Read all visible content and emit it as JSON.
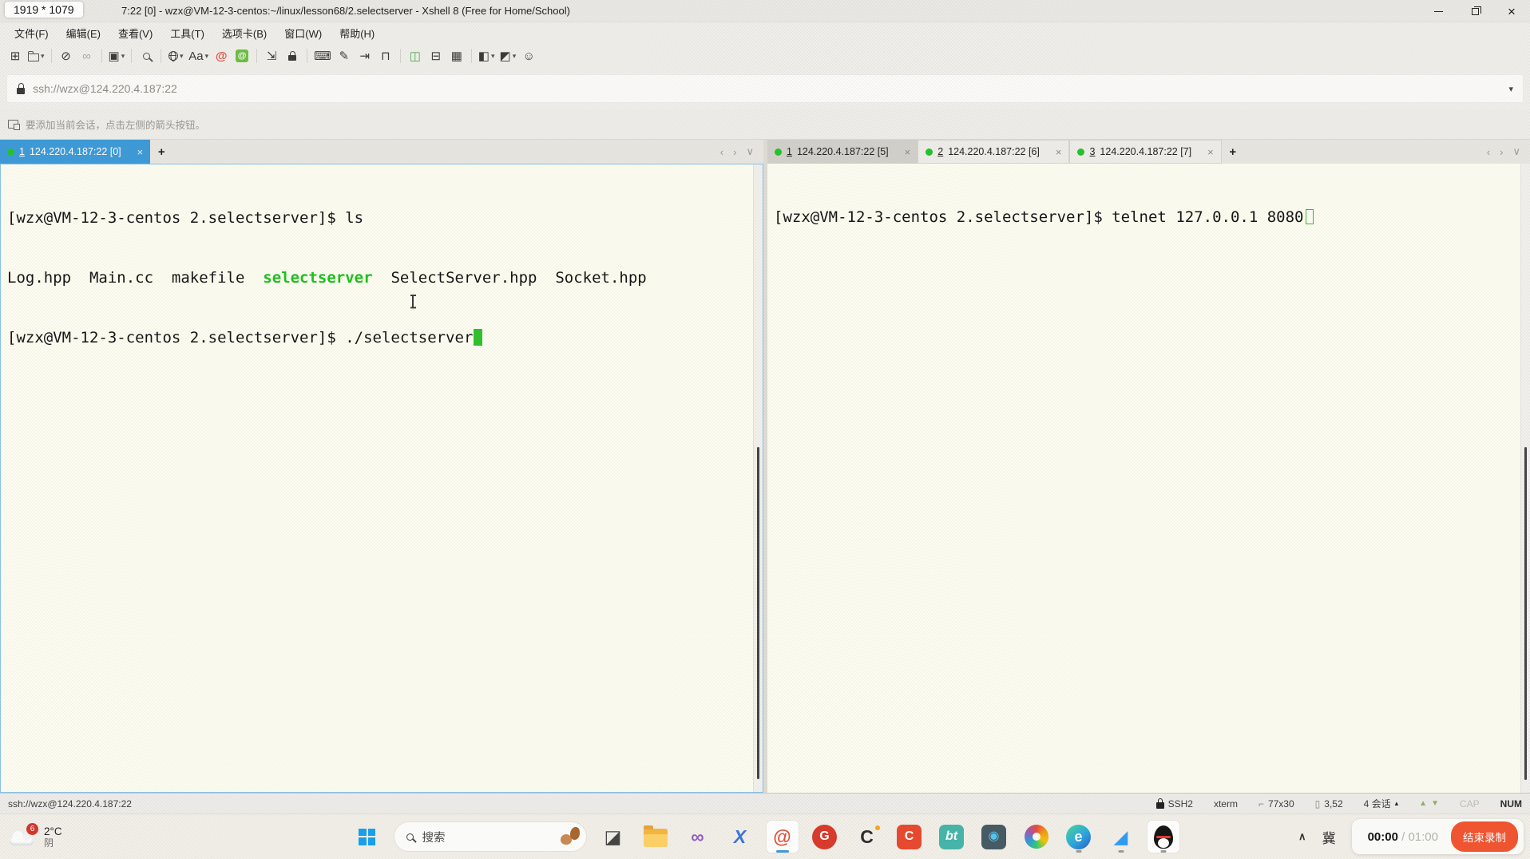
{
  "screen_badge": "1919 * 1079",
  "titlebar": {
    "title": "7:22 [0] - wzx@VM-12-3-centos:~/linux/lesson68/2.selectserver - Xshell 8 (Free for Home/School)"
  },
  "menubar": {
    "items": [
      "文件(F)",
      "编辑(E)",
      "查看(V)",
      "工具(T)",
      "选项卡(B)",
      "窗口(W)",
      "帮助(H)"
    ]
  },
  "toolbar": {
    "items": [
      {
        "name": "new-session-button",
        "glyph": "⊞"
      },
      {
        "name": "open-sessions-button",
        "css": "folder",
        "dropdown": true
      },
      {
        "sep": true
      },
      {
        "name": "disconnect-button",
        "glyph": "⊘"
      },
      {
        "name": "reconnect-button",
        "glyph": "∞",
        "disabled": true
      },
      {
        "sep": true
      },
      {
        "name": "new-terminal-tab-button",
        "glyph": "▣",
        "dropdown": true
      },
      {
        "sep": true
      },
      {
        "name": "find-button",
        "css": "search"
      },
      {
        "sep": true
      },
      {
        "name": "encoding-button",
        "css": "globe",
        "dropdown": true
      },
      {
        "name": "font-button",
        "glyph": "Aa",
        "dropdown": true
      },
      {
        "name": "xshell-logo-button",
        "glyph": "@",
        "color": "#E0523D",
        "bold": true
      },
      {
        "name": "xftp-transfer-button",
        "glyph": "@",
        "chip": "#6DBE45"
      },
      {
        "sep": true
      },
      {
        "name": "fullscreen-button",
        "glyph": "⇲"
      },
      {
        "name": "lock-screen-button",
        "css": "lock"
      },
      {
        "sep": true
      },
      {
        "name": "virtual-keyboard-button",
        "glyph": "⌨"
      },
      {
        "name": "highlight-pen-button",
        "glyph": "✎"
      },
      {
        "name": "send-text-button",
        "glyph": "⇥"
      },
      {
        "name": "compose-bar-button",
        "glyph": "⊓"
      },
      {
        "sep": true
      },
      {
        "name": "split-horizontal-button",
        "glyph": "◫",
        "color": "#4CAF50"
      },
      {
        "name": "split-vertical-button",
        "glyph": "⊟"
      },
      {
        "name": "tile-panes-button",
        "glyph": "▦"
      },
      {
        "sep": true
      },
      {
        "name": "layout-preset-button",
        "glyph": "◧",
        "dropdown": true
      },
      {
        "name": "layout-preset-2-button",
        "glyph": "◩",
        "dropdown": true
      },
      {
        "name": "feedback-button",
        "glyph": "☺"
      }
    ]
  },
  "addressbar": {
    "value": "ssh://wzx@124.220.4.187:22"
  },
  "infobar": {
    "message": "要添加当前会话，点击左侧的箭头按钮。"
  },
  "glyphs": {
    "close": "×",
    "plus": "+",
    "nav_prev": "‹",
    "nav_next": "›",
    "nav_more": "∨",
    "dropdown": "▾",
    "session_up": "▴",
    "arrow_up": "▲",
    "arrow_down": "▼",
    "size_icon": "⌐",
    "cursor_icon": "▯"
  },
  "panes": {
    "left": {
      "tabs": [
        {
          "number": "1",
          "label": "124.220.4.187:22 [0]",
          "state": "focused"
        }
      ],
      "terminal": {
        "line1": "[wzx@VM-12-3-centos 2.selectserver]$ ls",
        "line2_pre": "Log.hpp  Main.cc  makefile  ",
        "line2_highlight": "selectserver",
        "line2_post": "  SelectServer.hpp  Socket.hpp",
        "line3": "[wzx@VM-12-3-centos 2.selectserver]$ ./selectserver"
      }
    },
    "right": {
      "tabs": [
        {
          "number": "1",
          "label": "124.220.4.187:22 [5]",
          "state": "selected"
        },
        {
          "number": "2",
          "label": "124.220.4.187:22 [6]",
          "state": "normal"
        },
        {
          "number": "3",
          "label": "124.220.4.187:22 [7]",
          "state": "normal"
        }
      ],
      "terminal": {
        "line1": "[wzx@VM-12-3-centos 2.selectserver]$ telnet 127.0.0.1 8080"
      }
    }
  },
  "statusbar": {
    "session_url": "ssh://wzx@124.220.4.187:22",
    "protocol": "SSH2",
    "terminal_type": "xterm",
    "screen_size": "77x30",
    "cursor_position": "3,52",
    "session_count": "4 会话",
    "caps_indicator": "CAP",
    "num_indicator": "NUM"
  },
  "taskbar": {
    "weather": {
      "badge": "6",
      "temperature": "2°C",
      "condition": "阴"
    },
    "search": {
      "placeholder": "搜索"
    },
    "apps": [
      {
        "name": "photos-app-icon",
        "glyph": "◪",
        "fg": "#444444"
      },
      {
        "name": "file-explorer-icon",
        "css": "folder-lg"
      },
      {
        "name": "visual-studio-icon",
        "glyph": "∞",
        "fg": "#9160C1",
        "bold": true
      },
      {
        "name": "visual-studio-blue-icon",
        "glyph": "X",
        "fg": "#3B74D9",
        "bold": true,
        "italic": true
      },
      {
        "name": "xshell-icon",
        "glyph": "@",
        "fg": "#E0523D",
        "bold": true,
        "card": true,
        "indicator": "active"
      },
      {
        "name": "g-app-icon",
        "glyph": "G",
        "fg": "#ffffff",
        "bg": "#D93A2B",
        "round": true,
        "bold": true
      },
      {
        "name": "c-curve-app-icon",
        "glyph": "C",
        "fg": "#2b2b2b",
        "bold": true,
        "accentdot": "#F5A623"
      },
      {
        "name": "csdn-icon",
        "glyph": "C",
        "fg": "#ffffff",
        "bg": "#E8492F",
        "bold": true
      },
      {
        "name": "baota-panel-icon",
        "glyph": "bt",
        "fg": "#ffffff",
        "bg": "#45B5AA",
        "bold": true,
        "italic": true
      },
      {
        "name": "swirl-app-icon",
        "glyph": "◉",
        "fg": "#53C7F0",
        "bg": "#455A64"
      },
      {
        "name": "palette-app-icon",
        "css": "palette"
      },
      {
        "name": "edge-browser-icon",
        "css": "edge",
        "indicator": "running"
      },
      {
        "name": "vscode-icon",
        "glyph": "◢",
        "fg": "#2F9CF4",
        "indicator": "running"
      },
      {
        "name": "qq-icon",
        "css": "qq",
        "card": true,
        "indicator": "running"
      }
    ],
    "tray": {
      "chevron": "∧",
      "ime": "冀"
    },
    "recorder": {
      "elapsed": "00:00",
      "separator": " / ",
      "total": "01:00",
      "stop_label": "结束录制"
    }
  },
  "colors": {
    "focused_tab_blue": "#3D9AD8",
    "session_dot_green": "#23C32B",
    "terminal_green": "#1BC21B",
    "cursor_green": "#2EC12E",
    "record_button_red": "#F25430",
    "pane_border_blue": "#8AC2E8",
    "xshell_red": "#E0523D"
  }
}
